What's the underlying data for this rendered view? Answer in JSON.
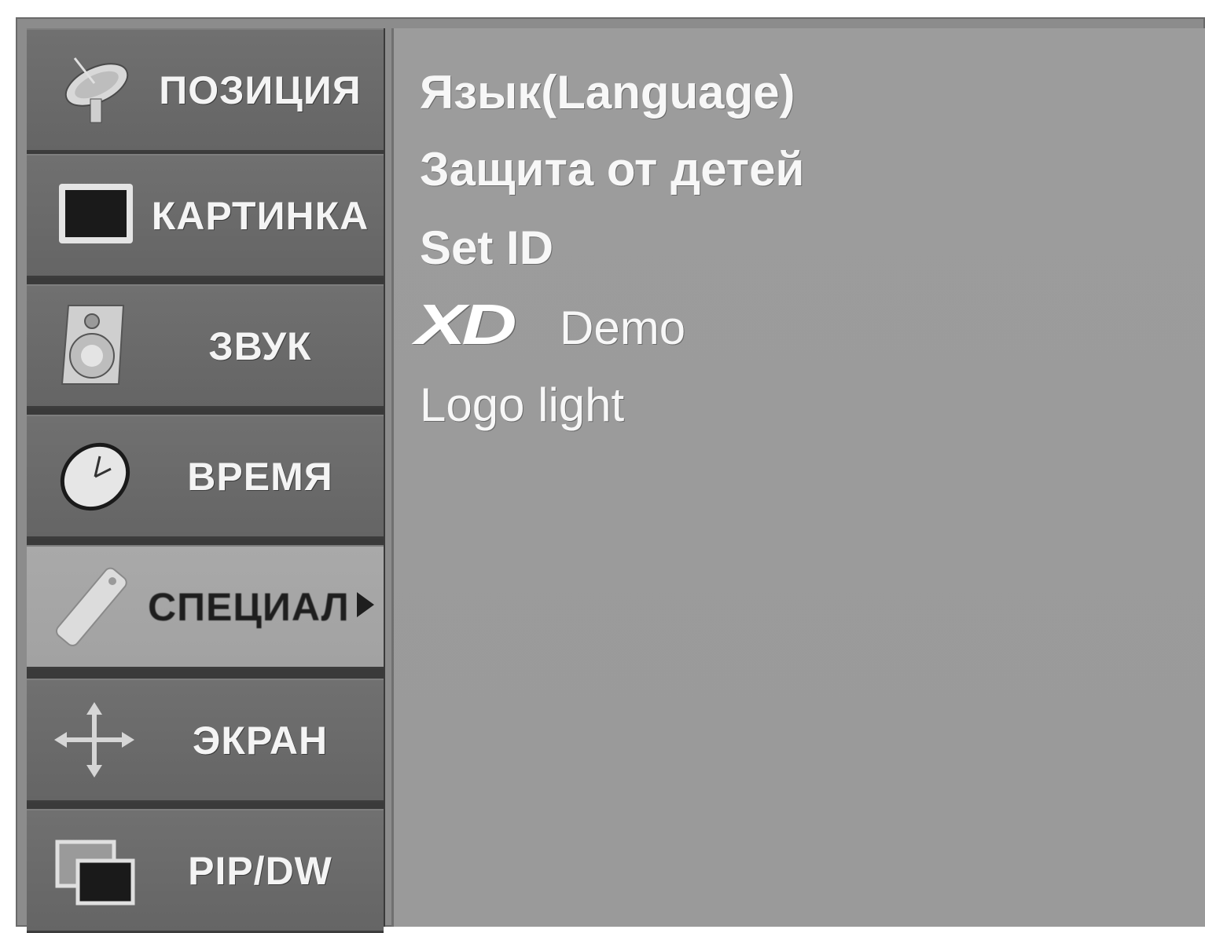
{
  "sidebar": {
    "items": [
      {
        "label": "ПОЗИЦИЯ",
        "icon": "satellite-dish-icon"
      },
      {
        "label": "КАРТИНКА",
        "icon": "picture-icon"
      },
      {
        "label": "ЗВУК",
        "icon": "speaker-icon"
      },
      {
        "label": "ВРЕМЯ",
        "icon": "clock-icon"
      },
      {
        "label": "СПЕЦИАЛ",
        "icon": "remote-control-icon",
        "active": true
      },
      {
        "label": "ЭКРАН",
        "icon": "move-arrows-icon"
      },
      {
        "label": "PIP/DW",
        "icon": "pip-windows-icon"
      }
    ]
  },
  "content": {
    "items": [
      {
        "label": "Язык(Language)"
      },
      {
        "label": "Защита от детей"
      },
      {
        "label": "Set ID"
      },
      {
        "logo": "XD",
        "label": "Demo"
      },
      {
        "label": "Logo light"
      }
    ]
  },
  "colors": {
    "sidebar_item": "#6e6e6e",
    "sidebar_active": "#a6a6a6",
    "content_panel": "#9b9b9b",
    "text": "#f4f4f4"
  }
}
